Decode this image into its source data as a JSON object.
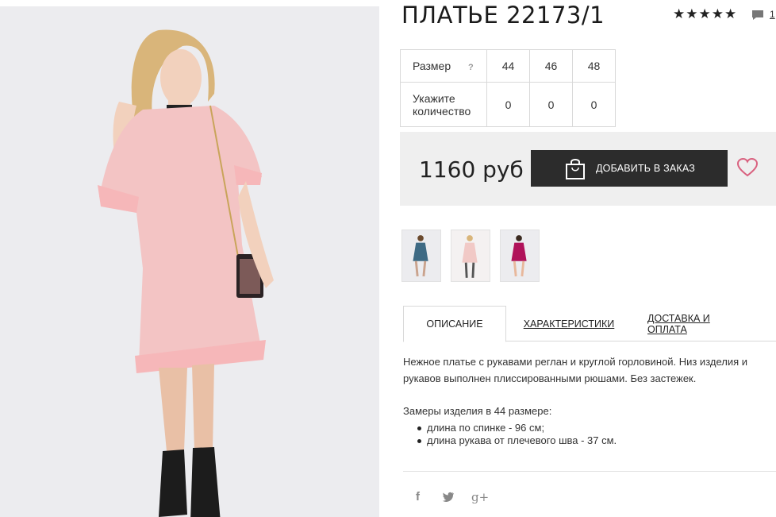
{
  "product": {
    "title": "ПЛАТЬЕ 22173/1",
    "rating_stars": 5,
    "comments_count": "1",
    "price": "1160 руб",
    "add_to_cart_label": "ДОБАВИТЬ В ЗАКАЗ"
  },
  "sizes": {
    "size_label": "Размер",
    "help": "?",
    "qty_label": "Укажите количество",
    "values": [
      "44",
      "46",
      "48"
    ],
    "quantities": [
      "0",
      "0",
      "0"
    ]
  },
  "thumbnails": [
    {
      "color": "#3e6a84"
    },
    {
      "color": "#f1c9c6"
    },
    {
      "color": "#b0125a"
    }
  ],
  "tabs": [
    {
      "label": "ОПИСАНИЕ"
    },
    {
      "label": "ХАРАКТЕРИСТИКИ"
    },
    {
      "label": "ДОСТАВКА И ОПЛАТА"
    }
  ],
  "description": {
    "text": "Нежное платье с рукавами реглан и круглой горловиной. Низ изделия и рукавов выполнен плиссированными рюшами. Без застежек.",
    "measure_title": "Замеры изделия в 44 размере:",
    "measures": [
      "длина по спинке - 96 см;",
      "длина рукава от плечевого шва - 37 см."
    ]
  },
  "social": {
    "facebook": "f",
    "googleplus": "g+"
  },
  "colors": {
    "accent_dark": "#2c2c2c",
    "heart": "#d9617f",
    "panel": "#efefef",
    "dress": "#f3c4c4"
  }
}
